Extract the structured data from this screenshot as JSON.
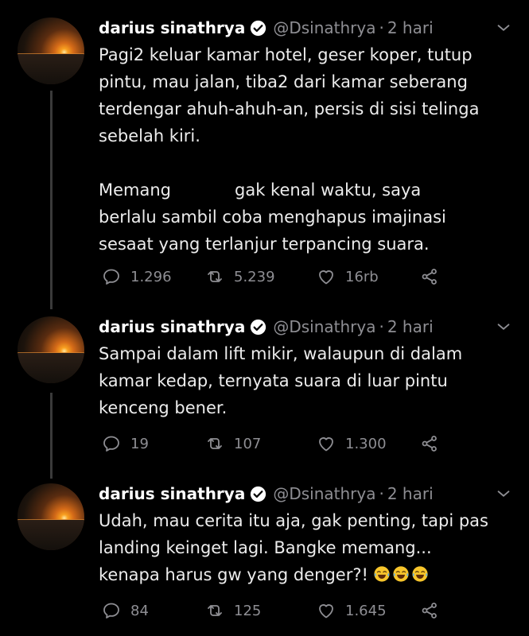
{
  "tweets": [
    {
      "name": "darius sinathrya",
      "handle": "@Dsinathrya",
      "separator": "·",
      "time": "2 hari",
      "lines": [
        "Pagi2 keluar kamar hotel, geser koper, tutup",
        "pintu, mau jalan, tiba2 dari kamar seberang",
        "terdengar ahuh-ahuh-an, persis di sisi telinga",
        "sebelah kiri.",
        "",
        "Memang",
        "berlalu sambil coba menghapus imajinasi",
        "sesaat yang terlanjur terpancing suara."
      ],
      "line6_suffix": "gak kenal waktu, saya",
      "replies": "1.296",
      "retweets": "5.239",
      "likes": "16rb"
    },
    {
      "name": "darius sinathrya",
      "handle": "@Dsinathrya",
      "separator": "·",
      "time": "2 hari",
      "lines": [
        "Sampai dalam lift mikir, walaupun di dalam",
        "kamar kedap, ternyata suara di luar pintu",
        "kenceng bener."
      ],
      "replies": "19",
      "retweets": "107",
      "likes": "1.300"
    },
    {
      "name": "darius sinathrya",
      "handle": "@Dsinathrya",
      "separator": "·",
      "time": "2 hari",
      "lines": [
        "Udah, mau cerita itu aja, gak penting, tapi pas",
        "landing keinget lagi. Bangke memang...",
        "kenapa harus gw yang denger?!"
      ],
      "emojis": [
        "face-with-tears-of-joy-icon",
        "face-with-tears-of-joy-icon",
        "face-with-tears-of-joy-icon"
      ],
      "replies": "84",
      "retweets": "125",
      "likes": "1.645"
    }
  ],
  "colors": {
    "background": "#000000",
    "text": "#ececec",
    "secondary": "#8e8e93",
    "thread_line": "#3a3a3a"
  }
}
